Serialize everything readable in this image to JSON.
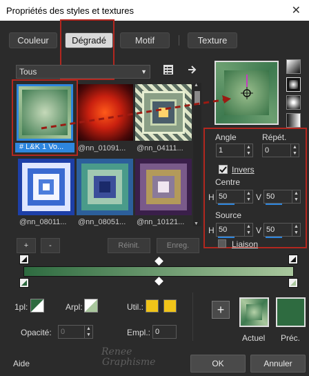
{
  "window": {
    "title": "Propriétés des styles et textures",
    "close_glyph": "✕"
  },
  "tabs": [
    {
      "label": "Couleur",
      "active": false
    },
    {
      "label": "Dégradé",
      "active": true
    },
    {
      "label": "Motif",
      "active": false
    },
    {
      "label": "Texture",
      "active": false
    }
  ],
  "filter": {
    "selected": "Tous"
  },
  "gallery": {
    "items": [
      {
        "caption": "# L&K 1 Vo...",
        "selected": true
      },
      {
        "caption": "@nn_01091..."
      },
      {
        "caption": "@nn_04111..."
      },
      {
        "caption": "@nn_08011..."
      },
      {
        "caption": "@nn_08051..."
      },
      {
        "caption": "@nn_10121..."
      }
    ],
    "add_label": "+",
    "remove_label": "-",
    "reset_label": "Réinit.",
    "save_label": "Enreg."
  },
  "settings": {
    "angle_label": "Angle",
    "angle_value": "1",
    "repeat_label": "Répét.",
    "repeat_value": "0",
    "invert_label": "Invers",
    "invert_checked": true,
    "center_label": "Centre",
    "center_h_label": "H",
    "center_h_value": "50",
    "center_v_label": "V",
    "center_v_value": "50",
    "source_label": "Source",
    "source_h_label": "H",
    "source_h_value": "50",
    "source_v_label": "V",
    "source_v_value": "50",
    "link_label": "Liaison"
  },
  "options": {
    "pl_label": "1pl:",
    "arpl_label": "Arpl:",
    "util_label": "Util.:",
    "opacity_label": "Opacité:",
    "opacity_value": "0",
    "empl_label": "Empl.:",
    "empl_value": "0"
  },
  "swatches": {
    "current_label": "Actuel",
    "previous_label": "Préc.",
    "add_label": "+"
  },
  "footer": {
    "help_label": "Aide",
    "ok_label": "OK",
    "cancel_label": "Annuler",
    "watermark_line1": "Renee",
    "watermark_line2": "Graphisme"
  },
  "colors": {
    "accent_red": "#b3271f",
    "highlight_blue": "#2e86de",
    "gradient_green": "#2e6b40",
    "gradient_light": "#a9c79d",
    "util_yellow": "#f0c419"
  }
}
